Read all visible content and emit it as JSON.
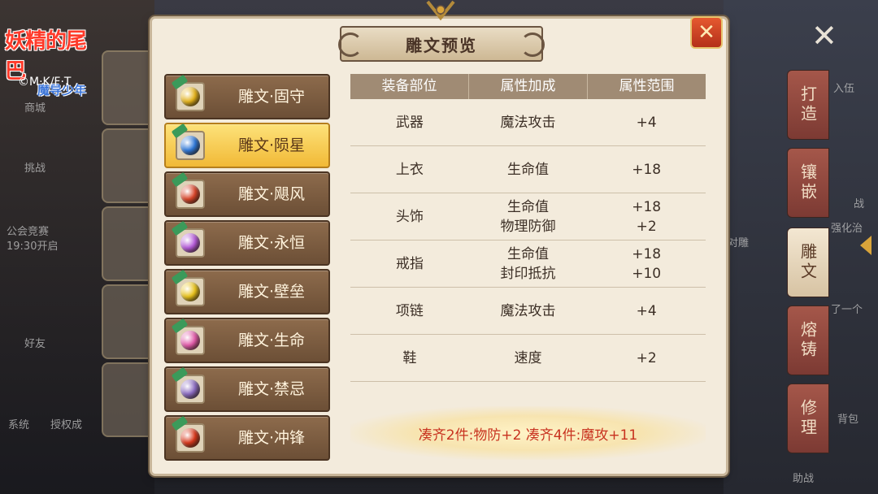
{
  "logo": {
    "title": "妖精的尾巴",
    "subtitle": "魔导少年",
    "copyright": "©M·K/F·T"
  },
  "background": {
    "left_labels": [
      "商城",
      "挑战",
      "公会竞赛",
      "19:30开启",
      "好友",
      "系统",
      "授权成"
    ],
    "right_labels": [
      "入伍",
      "战",
      "强化治",
      "对雕",
      "了一个",
      "背包",
      "助战"
    ]
  },
  "right_tabs": [
    {
      "label": "打造",
      "active": false
    },
    {
      "label": "镶嵌",
      "active": false
    },
    {
      "label": "雕文",
      "active": true
    },
    {
      "label": "熔铸",
      "active": false
    },
    {
      "label": "修理",
      "active": false
    }
  ],
  "modal": {
    "title": "雕文预览",
    "close_icon": "close-x-icon"
  },
  "runes": [
    {
      "label": "雕文·固守",
      "color": "#e3b21c",
      "selected": false
    },
    {
      "label": "雕文·陨星",
      "color": "#2f78d8",
      "selected": true
    },
    {
      "label": "雕文·飓风",
      "color": "#d8452a",
      "selected": false
    },
    {
      "label": "雕文·永恒",
      "color": "#b45ad8",
      "selected": false
    },
    {
      "label": "雕文·壁垒",
      "color": "#e8c21a",
      "selected": false
    },
    {
      "label": "雕文·生命",
      "color": "#e05aa8",
      "selected": false
    },
    {
      "label": "雕文·禁忌",
      "color": "#8a6ac0",
      "selected": false
    },
    {
      "label": "雕文·冲锋",
      "color": "#d8381c",
      "selected": false
    }
  ],
  "table": {
    "headers": [
      "装备部位",
      "属性加成",
      "属性范围"
    ],
    "rows": [
      {
        "part": "武器",
        "attrs": [
          "魔法攻击"
        ],
        "ranges": [
          "+4"
        ]
      },
      {
        "part": "上衣",
        "attrs": [
          "生命值"
        ],
        "ranges": [
          "+18"
        ]
      },
      {
        "part": "头饰",
        "attrs": [
          "生命值",
          "物理防御"
        ],
        "ranges": [
          "+18",
          "+2"
        ]
      },
      {
        "part": "戒指",
        "attrs": [
          "生命值",
          "封印抵抗"
        ],
        "ranges": [
          "+18",
          "+10"
        ]
      },
      {
        "part": "项链",
        "attrs": [
          "魔法攻击"
        ],
        "ranges": [
          "+4"
        ]
      },
      {
        "part": "鞋",
        "attrs": [
          "速度"
        ],
        "ranges": [
          "+2"
        ]
      }
    ]
  },
  "set_bonus": "凑齐2件:物防+2 凑齐4件:魔攻+11"
}
